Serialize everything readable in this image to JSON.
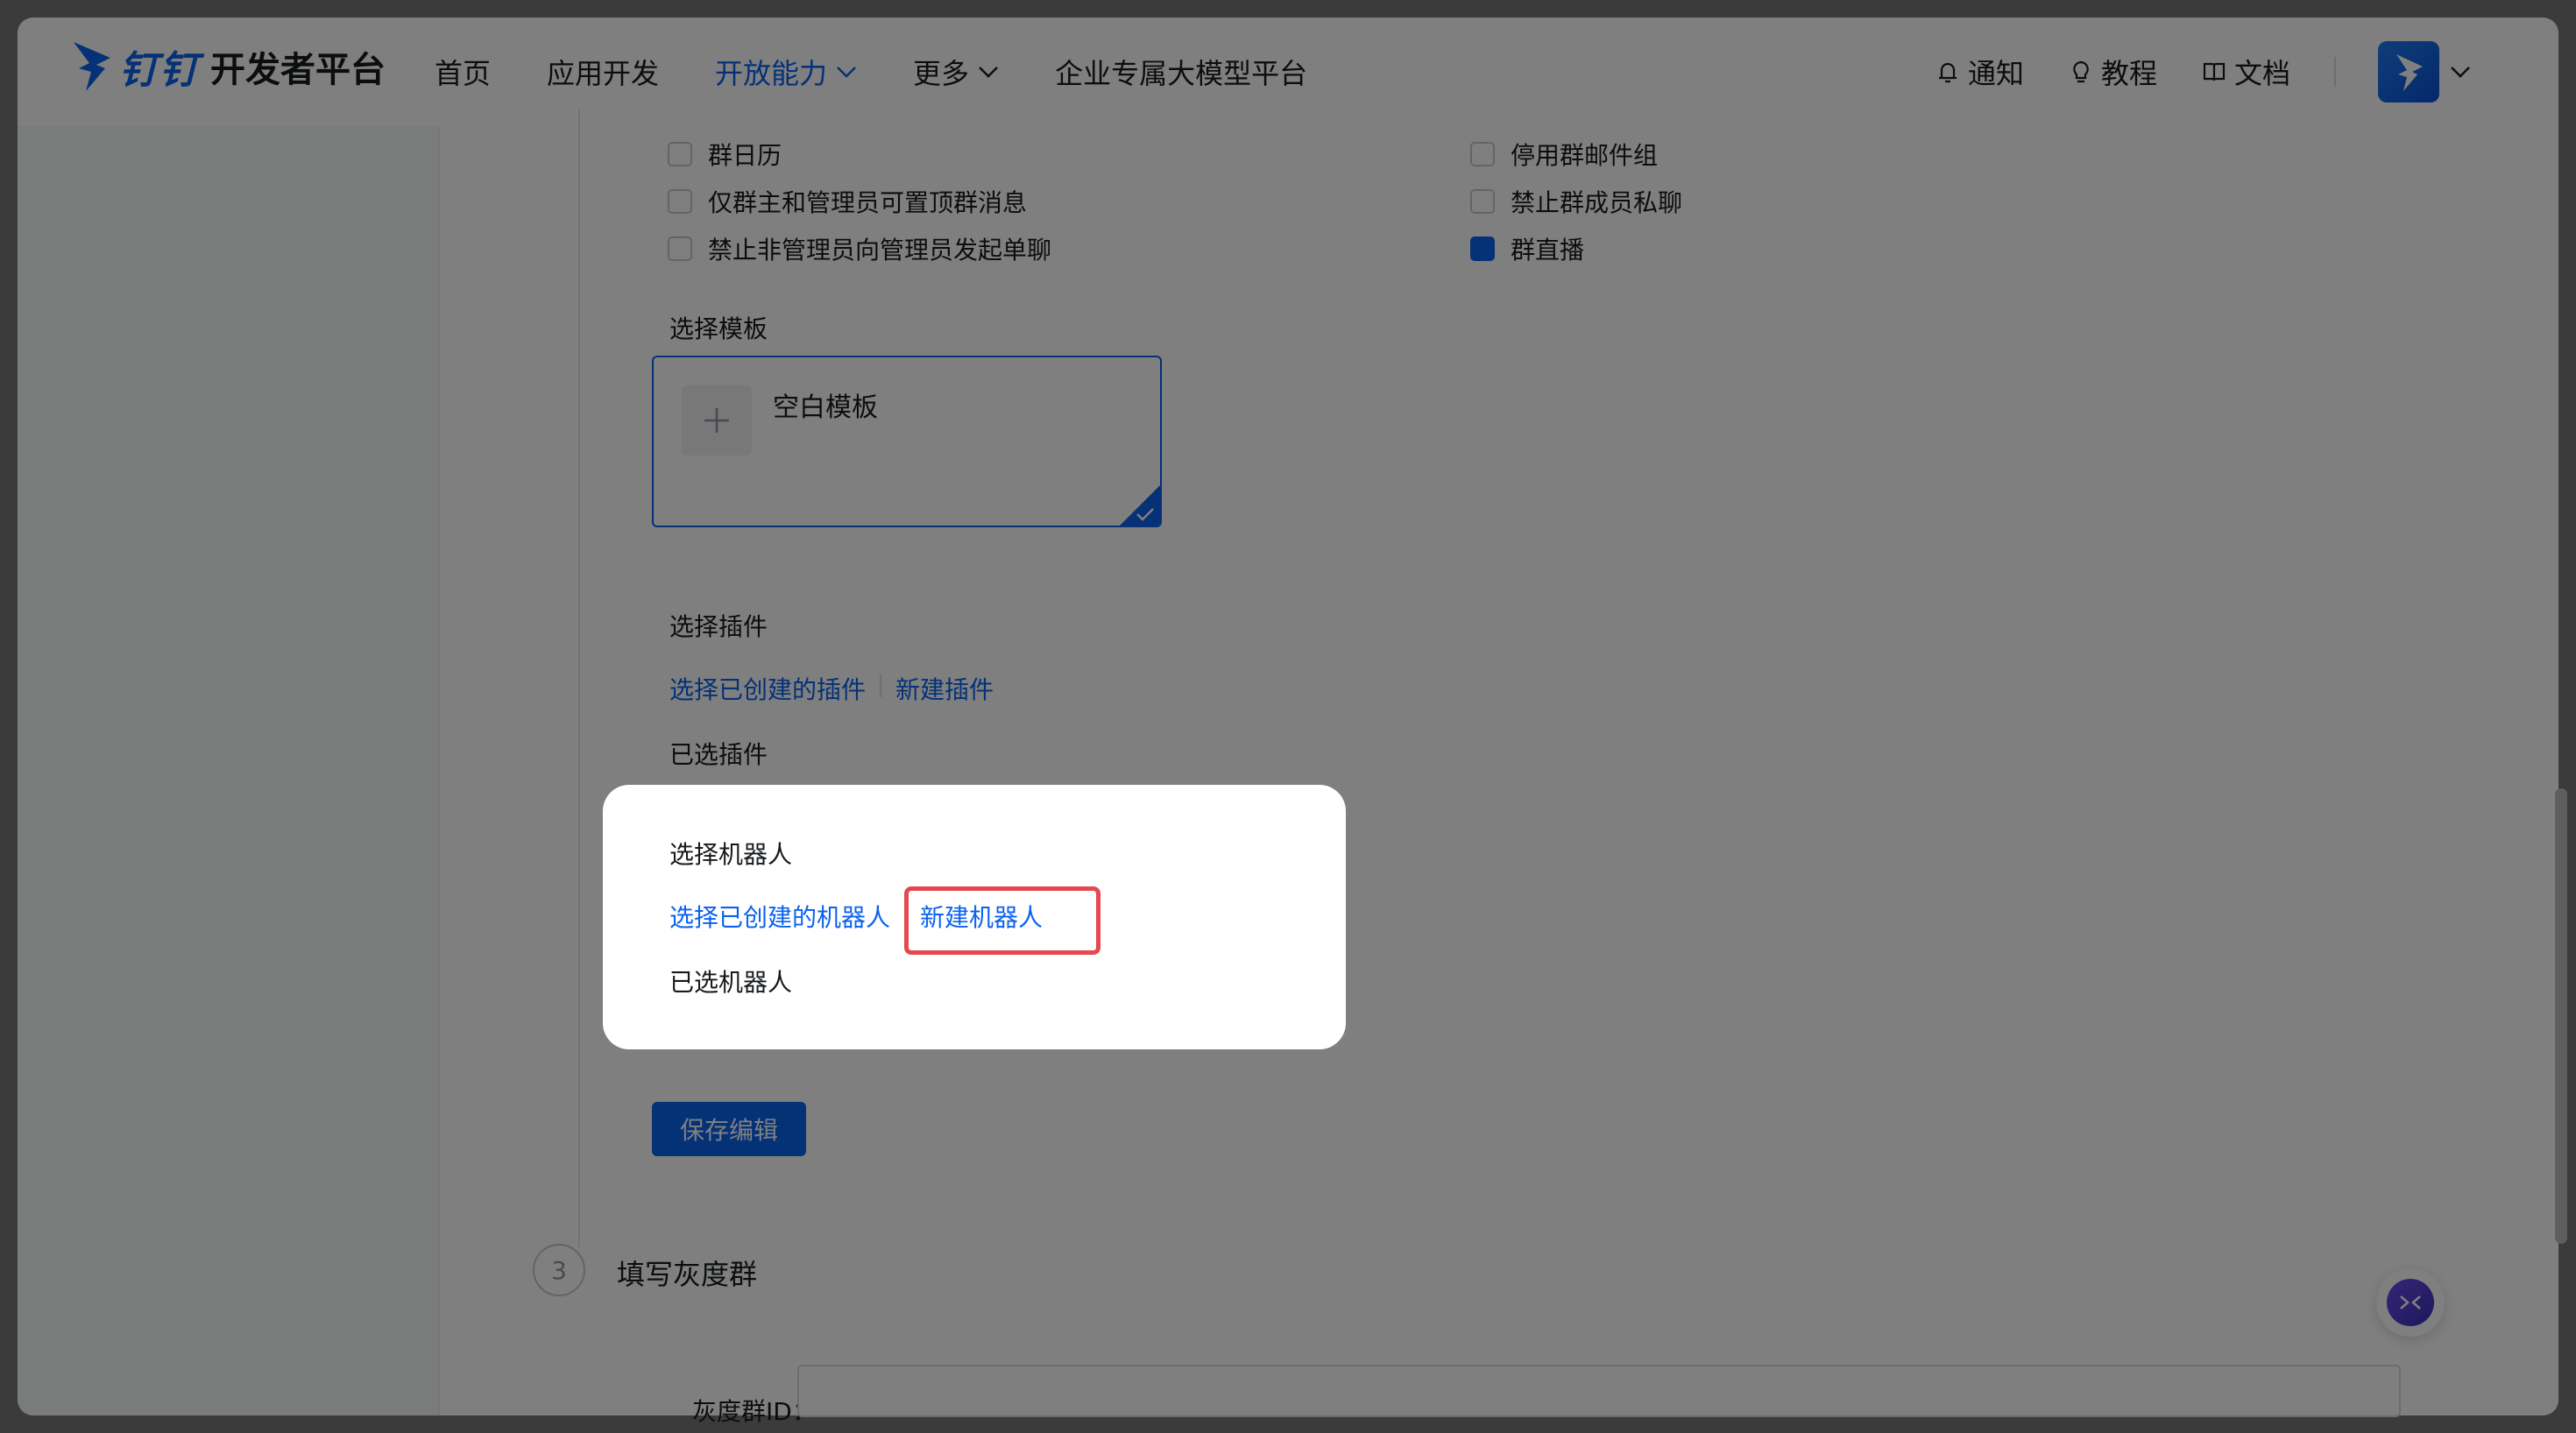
{
  "header": {
    "brand": "钉钉",
    "title": "开发者平台",
    "nav": [
      "首页",
      "应用开发",
      "开放能力",
      "更多",
      "企业专属大模型平台"
    ],
    "notify": "通知",
    "tutorial": "教程",
    "docs": "文档"
  },
  "options": {
    "left": [
      "群日历",
      "仅群主和管理员可置顶群消息",
      "禁止非管理员向管理员发起单聊"
    ],
    "right": [
      "停用群邮件组",
      "禁止群成员私聊",
      "群直播"
    ]
  },
  "template": {
    "section_label": "选择模板",
    "name": "空白模板"
  },
  "plugins": {
    "section_label": "选择插件",
    "select_existing": "选择已创建的插件",
    "create_new": "新建插件",
    "selected_label": "已选插件"
  },
  "robots": {
    "section_label": "选择机器人",
    "select_existing": "选择已创建的机器人",
    "create_new": "新建机器人",
    "selected_label": "已选机器人"
  },
  "save_button": "保存编辑",
  "step3": {
    "number": "3",
    "title": "填写灰度群",
    "field_label": "灰度群ID："
  },
  "colors": {
    "accent": "#0a62ef",
    "highlight": "#e5484d"
  }
}
